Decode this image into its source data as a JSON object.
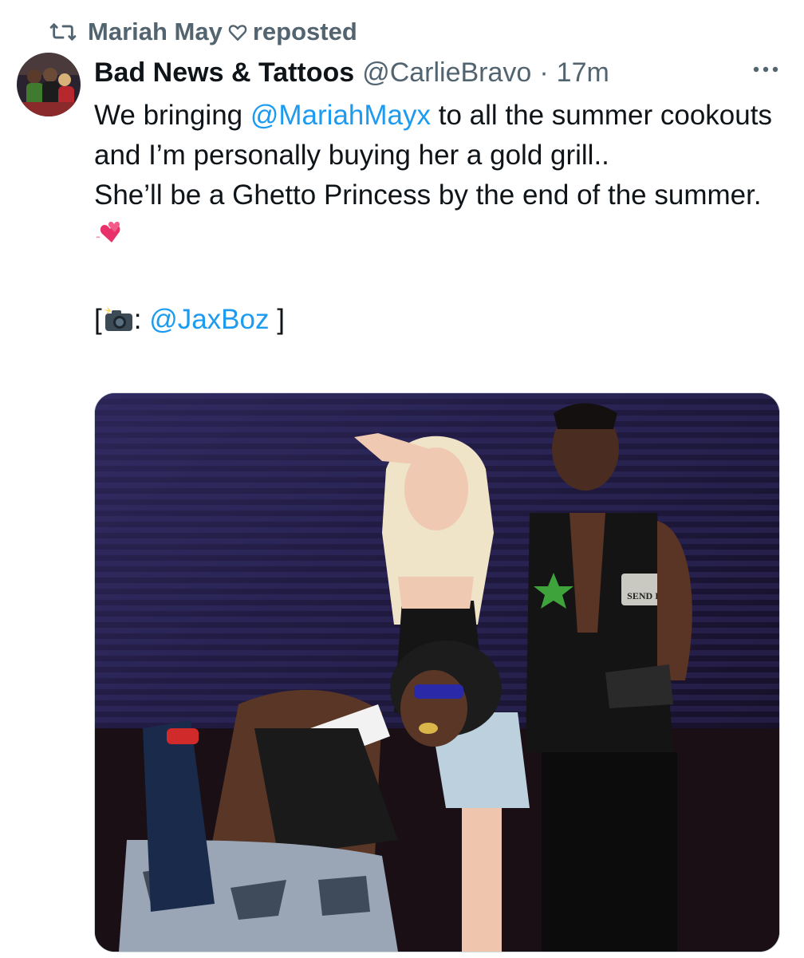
{
  "repost": {
    "user": "Mariah May",
    "label": "reposted",
    "icon": "repost-icon",
    "heart_icon": "heart-outline-icon"
  },
  "tweet": {
    "display_name": "Bad News & Tattoos",
    "handle": "@CarlieBravo",
    "separator": "·",
    "time": "17m",
    "more_icon": "more-horizontal-icon",
    "text": {
      "l1_pre": "We bringing ",
      "l1_mention": "@MariahMayx",
      "l1_post": " to all the summer cookouts and I’m personally buying her a gold grill..",
      "l2": "She’ll be a Ghetto Princess by the end of the summer.",
      "l2_emoji": "two-hearts-emoji",
      "l3_open": "[",
      "l3_emoji": "camera-flash-emoji",
      "l3_colon": ": ",
      "l3_mention": "@JaxBoz",
      "l3_close": " ]"
    },
    "media": {
      "kind": "photo",
      "vest_patch_text": "SEND IT"
    }
  },
  "colors": {
    "text": "#0f1419",
    "secondary": "#536471",
    "link": "#1d9bf0"
  }
}
